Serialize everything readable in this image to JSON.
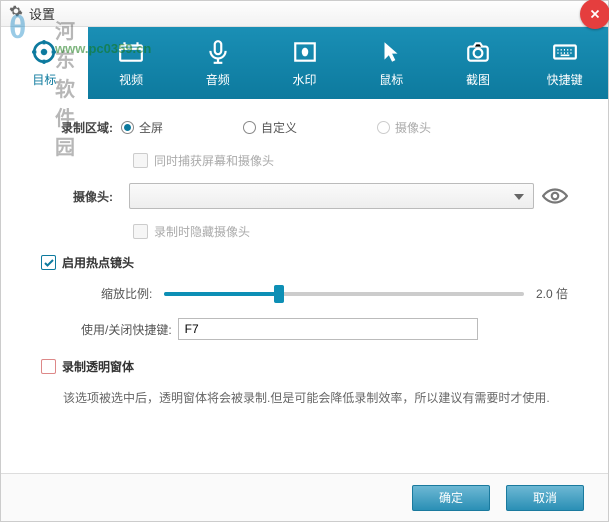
{
  "window": {
    "title": "设置"
  },
  "watermark": {
    "text1": "河东软件园",
    "text2": "www.pc0359.cn"
  },
  "tabs": [
    {
      "label": "目标"
    },
    {
      "label": "视频"
    },
    {
      "label": "音频"
    },
    {
      "label": "水印"
    },
    {
      "label": "鼠标"
    },
    {
      "label": "截图"
    },
    {
      "label": "快捷键"
    }
  ],
  "area": {
    "label": "录制区域:",
    "options": [
      {
        "label": "全屏",
        "checked": true
      },
      {
        "label": "自定义",
        "checked": false
      },
      {
        "label": "摄像头",
        "checked": false,
        "disabled": true
      }
    ],
    "capture_both": "同时捕获屏幕和摄像头"
  },
  "camera": {
    "label": "摄像头:",
    "hide_on_record": "录制时隐藏摄像头"
  },
  "hotspot": {
    "enable": "启用热点镜头",
    "zoom_label": "缩放比例:",
    "zoom_value": "2.0 倍",
    "hotkey_label": "使用/关闭快捷键:",
    "hotkey_value": "F7"
  },
  "transparent": {
    "enable": "录制透明窗体",
    "desc": "该选项被选中后，透明窗体将会被录制.但是可能会降低录制效率，所以建议有需要时才使用."
  },
  "buttons": {
    "ok": "确定",
    "cancel": "取消"
  }
}
